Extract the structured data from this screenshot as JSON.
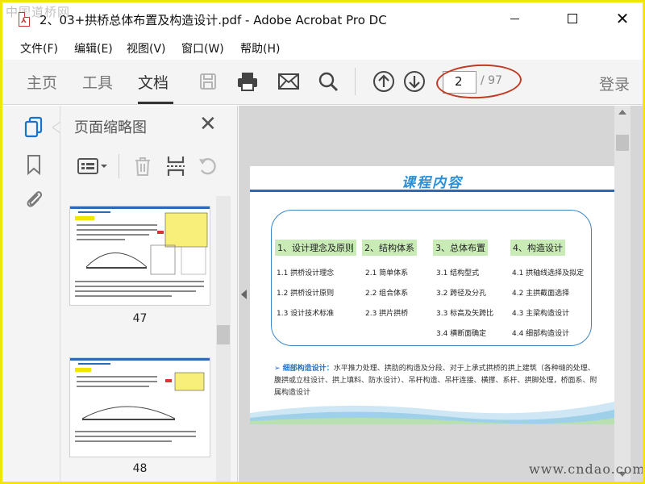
{
  "window": {
    "title": "2、03+拱桥总体布置及构造设计.pdf - Adobe Acrobat Pro DC",
    "watermark_text": "中国道桥网"
  },
  "menu": {
    "items": [
      "文件(F)",
      "编辑(E)",
      "视图(V)",
      "窗口(W)",
      "帮助(H)"
    ]
  },
  "toolbar": {
    "tabs": [
      "主页",
      "工具",
      "文档"
    ],
    "active_tab": "文档",
    "current_page": "2",
    "total_pages": "/ 97",
    "login_label": "登录",
    "icons": [
      "save-icon",
      "print-icon",
      "email-icon",
      "search-icon",
      "page-up-icon",
      "page-down-icon"
    ]
  },
  "sidebar": {
    "icons": [
      "page-thumbnails-icon",
      "bookmark-icon",
      "attachment-icon"
    ]
  },
  "thumbnails_panel": {
    "title": "页面缩略图",
    "tool_icons": [
      "thumbnail-options-icon",
      "delete-page-icon",
      "insert-page-icon",
      "rotate-page-icon"
    ],
    "pages": [
      {
        "number": "47"
      },
      {
        "number": "48"
      }
    ]
  },
  "document_page": {
    "heading": "课程内容",
    "columns": [
      {
        "category": "1、设计理念及原则",
        "items": [
          "1.1 拱桥设计理念",
          "1.2 拱桥设计原则",
          "1.3 设计技术标准"
        ]
      },
      {
        "category": "2、结构体系",
        "items": [
          "2.1 简单体系",
          "2.2 组合体系",
          "2.3 拱片拱桥"
        ]
      },
      {
        "category": "3、总体布置",
        "items": [
          "3.1 结构型式",
          "3.2 跨径及分孔",
          "3.3 标高及矢跨比",
          "3.4 横断面确定"
        ]
      },
      {
        "category": "4、构造设计",
        "items": [
          "4.1 拱轴线选择及拟定",
          "4.2 主拱截面选择",
          "4.3 主梁构造设计",
          "4.4 细部构造设计"
        ]
      }
    ],
    "note_lead": "➢ 细部构造设计：",
    "note_text": "水平推力处理、拱肋的构造及分段、对于上承式拱桥的拱上建筑（各种缝的处理、腹拱或立柱设计、拱上填料、防水设计）、吊杆构造、吊杆连接、横撑、系杆、拱脚处理，桥面系、附属构造设计"
  },
  "site_watermark": "www.cndao.com",
  "colors": {
    "frame": "#f2e600",
    "category_fill": "#c9ebb6",
    "heading_blue": "#2a8fd6",
    "annotation_oval": "#c23a24"
  }
}
